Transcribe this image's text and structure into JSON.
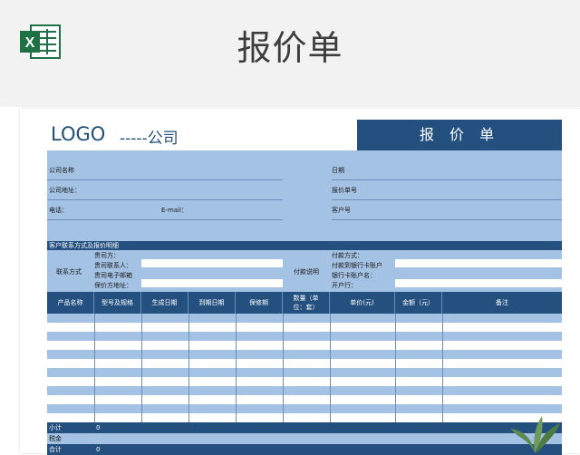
{
  "page": {
    "title": "报价单"
  },
  "app_icon": {
    "name": "excel-icon",
    "letter": "X"
  },
  "sheet": {
    "logo": "LOGO",
    "company": "-----公司",
    "doc_title": "报 价 单",
    "info": {
      "company_name": "公司名称",
      "company_address": "公司地址：",
      "phone": "电话：",
      "email": "E-mail：",
      "date": "日期",
      "quote_no": "报价单号",
      "customer_no": "客户号"
    },
    "section_title": "客户联系方式及报价明细",
    "contact": {
      "label": "联系方式",
      "your_side": "贵司方：",
      "contact_person": "贵司联系人：",
      "email": "贵司电子邮箱",
      "our_address": "保价方地址：",
      "payment_label": "付款说明",
      "payment_method": "付款方式：",
      "bank_account": "付款到银行卡账户",
      "account_name": "银行卡账户名：",
      "bank": "开户行："
    },
    "columns": [
      "产品名称",
      "型号及规格",
      "生成日期",
      "到期日期",
      "保修期",
      "数量（单位：套）",
      "单价(元)",
      "金额（元）",
      "备注"
    ],
    "totals": {
      "subtotal_label": "小计",
      "subtotal_value": "0",
      "tax_label": "税金",
      "total_label": "合计",
      "total_value": "0"
    }
  },
  "colors": {
    "header_blue": "#23507f",
    "light_blue": "#a4c2e3",
    "excel_green": "#1e7145"
  }
}
